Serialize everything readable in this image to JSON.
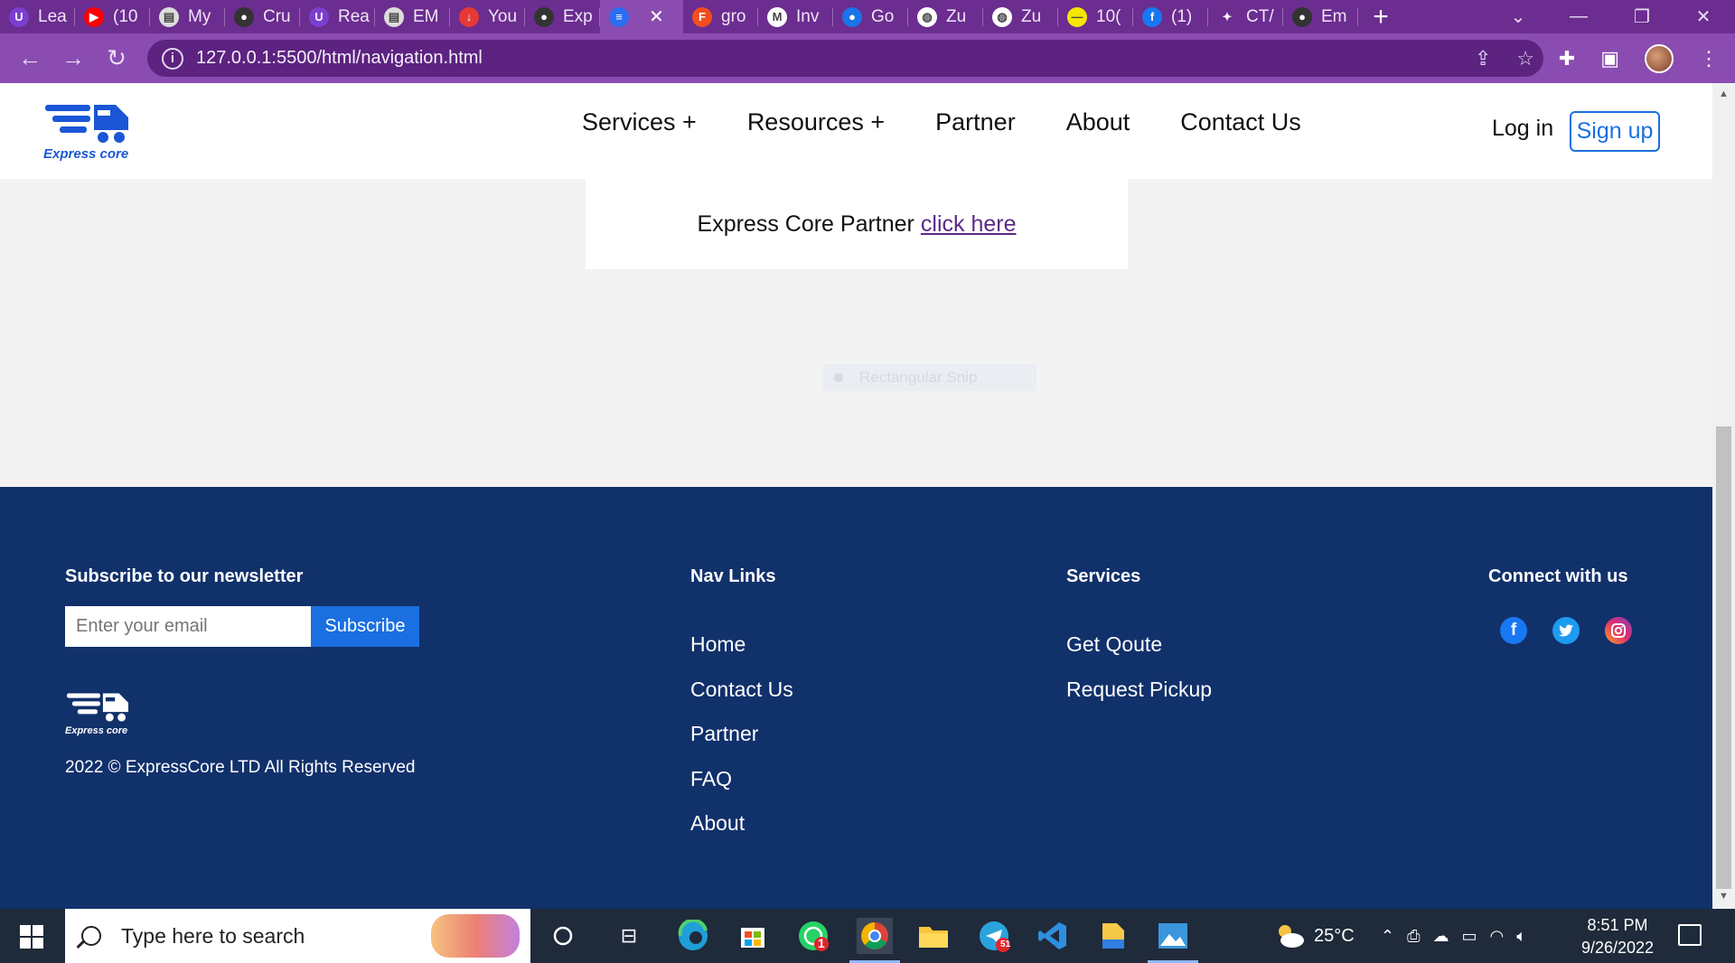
{
  "browser": {
    "tabs": [
      {
        "label": "Lea",
        "fav_color": "#7b3fd0",
        "fav_char": "U"
      },
      {
        "label": "(10",
        "fav_color": "#ff0000",
        "fav_char": "▶"
      },
      {
        "label": "My",
        "fav_color": "#dddddd",
        "fav_char": "▤"
      },
      {
        "label": "Cru",
        "fav_color": "#333333",
        "fav_char": "●"
      },
      {
        "label": "Rea",
        "fav_color": "#7b3fd0",
        "fav_char": "U"
      },
      {
        "label": "EM",
        "fav_color": "#dddddd",
        "fav_char": "▤"
      },
      {
        "label": "You",
        "fav_color": "#e53935",
        "fav_char": "↓"
      },
      {
        "label": "Exp",
        "fav_color": "#333333",
        "fav_char": "●"
      },
      {
        "label": "",
        "fav_color": "#2b6cf0",
        "fav_char": "≡",
        "active": true
      },
      {
        "label": "gro",
        "fav_color": "#f24e1e",
        "fav_char": "F"
      },
      {
        "label": "Inv",
        "fav_color": "#ffffff",
        "fav_char": "M"
      },
      {
        "label": "Go",
        "fav_color": "#1a73e8",
        "fav_char": "●"
      },
      {
        "label": "Zu",
        "fav_color": "#ffffff",
        "fav_char": "◍"
      },
      {
        "label": "Zu",
        "fav_color": "#ffffff",
        "fav_char": "◍"
      },
      {
        "label": "10(",
        "fav_color": "#f6e600",
        "fav_char": "—"
      },
      {
        "label": "(1)",
        "fav_color": "#1877f2",
        "fav_char": "f"
      },
      {
        "label": "CT/",
        "fav_color": "#6b2d8f",
        "fav_char": "✦"
      },
      {
        "label": "Em",
        "fav_color": "#333333",
        "fav_char": "●"
      }
    ],
    "url": "127.0.0.1:5500/html/navigation.html"
  },
  "site": {
    "logo_text": "Express core",
    "nav": [
      "Services +",
      "Resources +",
      "Partner",
      "About",
      "Contact Us"
    ],
    "login": "Log in",
    "signup": "Sign up",
    "partner_text": "Express Core Partner",
    "partner_link": "click here",
    "ghost_snip": "Rectangular Snip"
  },
  "footer": {
    "newsletter_heading": "Subscribe to our newsletter",
    "email_placeholder": "Enter your email",
    "subscribe_label": "Subscribe",
    "logo_text": "Express core",
    "copyright": "2022 © ExpressCore LTD All Rights Reserved",
    "nav_heading": "Nav Links",
    "nav_links": [
      "Home",
      "Contact Us",
      "Partner",
      "FAQ",
      "About"
    ],
    "services_heading": "Services",
    "services_links": [
      "Get Qoute",
      "Request Pickup"
    ],
    "connect_heading": "Connect with us",
    "social": [
      {
        "name": "facebook-icon",
        "color": "#1877f2",
        "char": "f"
      },
      {
        "name": "twitter-icon",
        "color": "#1d9bf0",
        "char": "t"
      },
      {
        "name": "instagram-icon",
        "color": "#e1306c",
        "char": "◎"
      }
    ]
  },
  "taskbar": {
    "search_placeholder": "Type here to search",
    "weather": "25°C",
    "time": "8:51 PM",
    "date": "9/26/2022",
    "whatsapp_badge": "1",
    "telegram_badge": "51"
  }
}
